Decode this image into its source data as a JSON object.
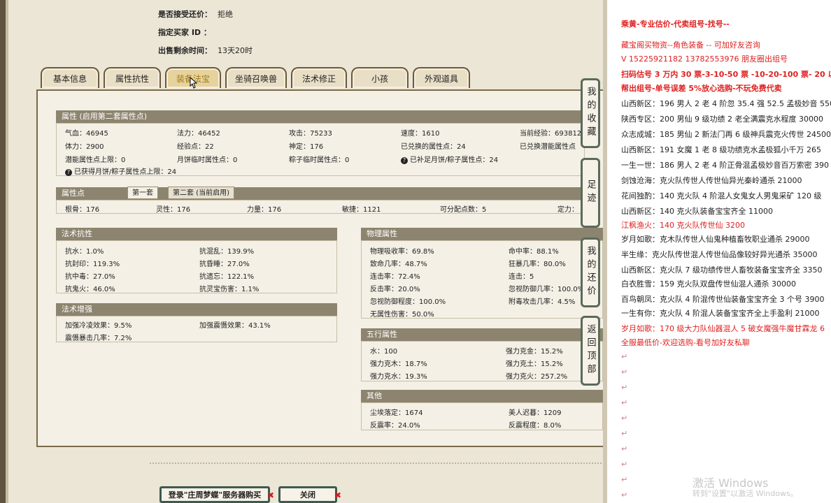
{
  "header": {
    "accept_label": "是否接受还价：",
    "accept_value": "拒绝",
    "buyer_label": "指定买家 ID ：",
    "buyer_value": "",
    "remain_label": "出售剩余时间：",
    "remain_value": "13天20时"
  },
  "tabs": [
    "基本信息",
    "属性抗性",
    "装备法宝",
    "坐骑召唤兽",
    "法术修正",
    "小孩",
    "外观道具"
  ],
  "active_tab": "装备法宝",
  "attr": {
    "title": "属性 (启用第二套属性点)",
    "row1": [
      "气血：46945",
      "法力：46452",
      "攻击：75233",
      "速度：1610",
      "当前经验：693812"
    ],
    "row2": [
      "体力：2900",
      "经验点：22",
      "神定：176",
      "已兑换的属性点：24",
      "已兑换潜能属性点"
    ],
    "row3": [
      "潜能属性点上限：0",
      "月饼临时属性点：0",
      "粽子临时属性点：0",
      "已补足月饼/粽子属性点：24"
    ],
    "row4": "已获得月饼/粽子属性点上限：24"
  },
  "points": {
    "title": "属性点",
    "sub_tab1": "第一套",
    "sub_tab2": "第二套 (当前启用)",
    "values": [
      "根骨：176",
      "灵性：176",
      "力量：176",
      "敏捷：1121",
      "可分配点数：5",
      "定力："
    ]
  },
  "fashu": {
    "title": "法术抗性",
    "items": [
      "抗水：1.0%",
      "抗混乱：139.9%",
      "抗封印：119.3%",
      "抗昏睡：27.0%",
      "抗中毒：27.0%",
      "抗遗忘：122.1%",
      "抗鬼火：46.0%",
      "抗灵宝伤害：1.1%"
    ]
  },
  "zengqiang": {
    "title": "法术增强",
    "items": [
      "加强冷凌效果：9.5%",
      "加强震慑效果：43.1%",
      "震慑暴击几率：7.2%"
    ]
  },
  "wuli": {
    "title": "物理属性",
    "items": [
      "物理吸收率：69.8%",
      "命中率：88.1%",
      "致命几率：48.7%",
      "狂暴几率：80.0%",
      "连击率：72.4%",
      "连击：5",
      "反击率：20.0%",
      "忽视防御几率：100.0%",
      "忽视防御程度：100.0%",
      "附毒攻击几率：4.5%",
      "无属性伤害：50.0%"
    ]
  },
  "wuxing": {
    "title": "五行属性",
    "items": [
      "水：100",
      "强力克金：15.2%",
      "强力克木：18.7%",
      "强力克土：15.2%",
      "强力克水：19.3%",
      "强力克火：257.2%"
    ]
  },
  "qita": {
    "title": "其他",
    "items": [
      "尘埃落定：1674",
      "美人迟暮：1209",
      "反震率：24.0%",
      "反震程度：8.0%"
    ]
  },
  "side_buttons": [
    "我的收藏",
    "足迹",
    "我的还价",
    "返回顶部"
  ],
  "bottom_buttons": {
    "login": "登录\"庄周梦蝶\"服务器购买",
    "close": "关闭"
  },
  "right": {
    "title": "乘黄-专业估价-代卖组号-找号--",
    "lines": [
      {
        "t": "藏宝阁买物资--角色装备 -- 可加好友咨询",
        "c": "red"
      },
      {
        "t": "V 15225921182   13782553976 朋友圈出组号",
        "c": "red"
      },
      {
        "t": "扫码估号 3 万内 30 票-3-10-50 票  -10-20-100 票- 20 以上",
        "c": "redb"
      },
      {
        "t": "帮出组号-单号误差 5%放心选购-不玩免费代卖",
        "c": "redb"
      },
      {
        "t": "山西新区：196 男人 2 老 4 阶忽 35.4 强 52.5 孟极妙音 5500",
        "c": ""
      },
      {
        "t": "陕西专区：200 男仙 9 级功绩 2 老全满震克水程度 30000",
        "c": ""
      },
      {
        "t": "众志成城：185 男仙 2 新法门再 6 级神兵震克火传世 24500",
        "c": ""
      },
      {
        "t": "山西新区：191 女魔 1 老 8 级功绩克水孟极狐小千万 265",
        "c": ""
      },
      {
        "t": "一生一世：186 男人 2 老 4 阶正骨混孟极妙音百万索密 390",
        "c": ""
      },
      {
        "t": "剑蚀沧海：克火队传世人传世仙异光秦岭通杀 21000",
        "c": ""
      },
      {
        "t": "花间独酌：140 克火队 4 阶混人女鬼女人男鬼采矿 120 级",
        "c": ""
      },
      {
        "t": "山西新区：140 克火队装备宝宝齐全 11000",
        "c": ""
      },
      {
        "t": "江枫渔火：140 克火队传世仙 3200",
        "c": "red"
      },
      {
        "t": "岁月如歌：克木队传世人仙鬼种植畜牧职业通杀 29000",
        "c": ""
      },
      {
        "t": "半生缘：克火队传世混人传世仙品像较好异光通杀 35000",
        "c": ""
      },
      {
        "t": "山西新区：克火队 7 级功绩传世人畜牧装备宝宝齐全 3350",
        "c": ""
      },
      {
        "t": "白衣胜雪：159 克火队双盘传世仙混人通杀 30000",
        "c": ""
      },
      {
        "t": "百鸟朝凤：克火队 4 阶混传世仙装备宝宝齐全 3 个号 3900",
        "c": ""
      },
      {
        "t": "一生有你：克火队 4 阶混人装备宝宝齐全上手盈利 21000",
        "c": ""
      },
      {
        "t": "岁月如歌：170 级大力队仙器混人 5 破女魔强牛魔甘霖龙 6",
        "c": "red"
      },
      {
        "t": "全服最低价-欢迎选购-看号加好友私聊",
        "c": "red"
      }
    ],
    "para_marks": [
      "↵",
      "↵",
      "↵",
      "↵",
      "↵",
      "↵",
      "↵",
      "↵",
      "↵",
      "↵"
    ],
    "watermark": "激活 Windows",
    "watermark_sub": "转到\"设置\"以激活 Windows。"
  }
}
